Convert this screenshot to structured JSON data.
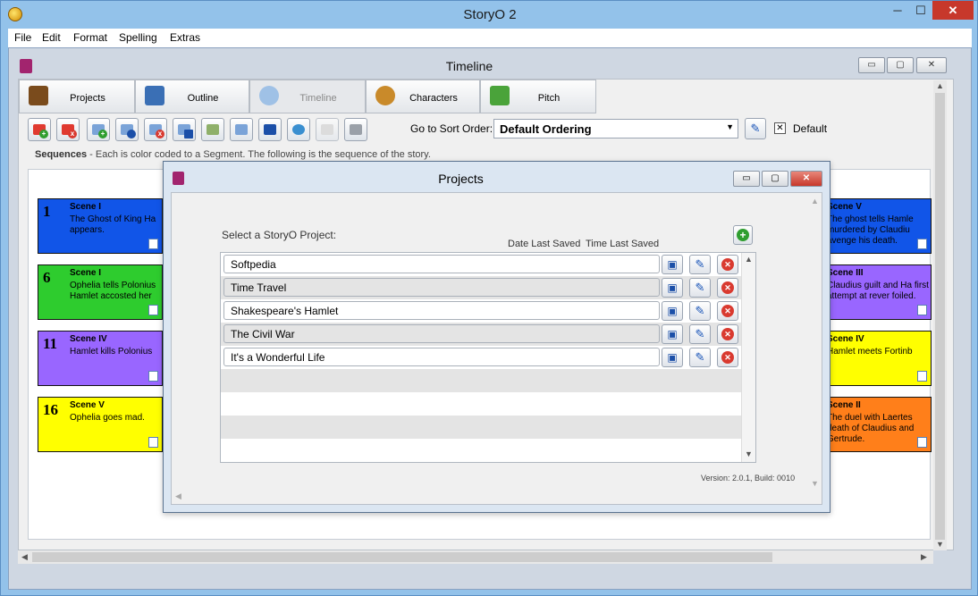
{
  "window": {
    "title": "StoryO 2",
    "min": "─",
    "max": "☐",
    "close": "✕"
  },
  "menu": [
    "File",
    "Edit",
    "Format",
    "Spelling",
    "Extras"
  ],
  "timeline_window": {
    "title": "Timeline",
    "min": "▭",
    "max": "▢",
    "close": "✕"
  },
  "tabs": [
    {
      "label": "Projects",
      "color": "#7a4b1c"
    },
    {
      "label": "Outline",
      "color": "#3a6fb5"
    },
    {
      "label": "Timeline",
      "color": "#4b8fd0"
    },
    {
      "label": "Characters",
      "color": "#c98a2a"
    },
    {
      "label": "Pitch",
      "color": "#4aa33a"
    }
  ],
  "sort": {
    "label": "Go to Sort Order:",
    "value": "Default Ordering",
    "default_label": "Default",
    "checked": "✕"
  },
  "sequences": {
    "title": "Sequences",
    "text": " - Each is color coded to a Segment. The following is the sequence of the story."
  },
  "scenes_left": [
    {
      "num": "1",
      "head": "Scene I",
      "text": "The Ghost of King Ha appears.",
      "color": "#1155e8"
    },
    {
      "num": "6",
      "head": "Scene I",
      "text": "Ophelia tells Polonius Hamlet accosted her",
      "color": "#2ecc2e"
    },
    {
      "num": "11",
      "head": "Scene IV",
      "text": "Hamlet kills Polonius",
      "color": "#9966ff"
    },
    {
      "num": "16",
      "head": "Scene V",
      "text": "Ophelia goes mad.",
      "color": "#ffff00"
    }
  ],
  "scenes_right": [
    {
      "head": "Scene V",
      "text": "The ghost tells Hamle murdered by Claudiu avenge his death.",
      "color": "#1155e8"
    },
    {
      "head": "Scene III",
      "text": "Claudius guilt and Ha first attempt at rever foiled.",
      "color": "#9966ff"
    },
    {
      "head": "Scene IV",
      "text": "Hamlet meets Fortinb",
      "color": "#ffff00"
    },
    {
      "head": "Scene II",
      "text": "The duel with Laertes death of Claudius and Gertrude.",
      "color": "#ff7f1a"
    }
  ],
  "projects_dialog": {
    "title": "Projects",
    "select_label": "Select a StoryO Project:",
    "col_date": "Date Last Saved",
    "col_time": "Time Last Saved",
    "add_icon": "+",
    "projects": [
      "Softpedia",
      "Time Travel",
      "Shakespeare's Hamlet",
      "The Civil War",
      "It's a Wonderful Life"
    ],
    "save_icon": "💾",
    "edit_icon": "✎",
    "delete_icon": "✕",
    "version": "Version: 2.0.1, Build: 0010"
  }
}
